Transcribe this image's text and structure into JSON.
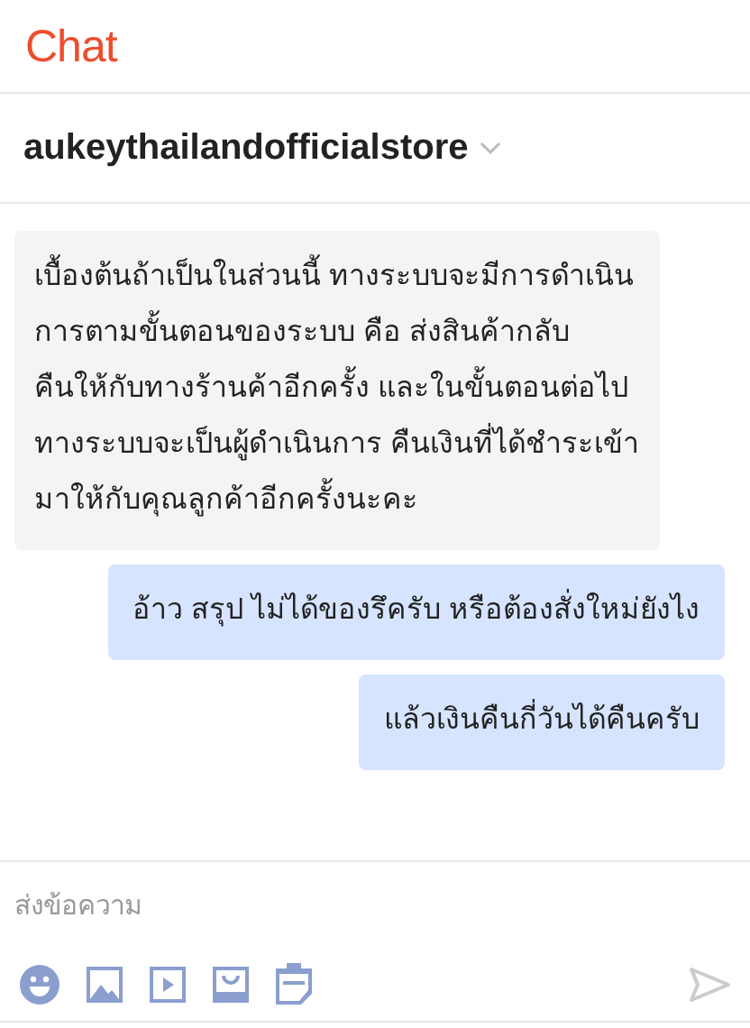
{
  "header": {
    "title": "Chat"
  },
  "conversation": {
    "name": "aukeythailandofficialstore"
  },
  "messages": [
    {
      "kind": "received",
      "text": "เบื้องต้นถ้าเป็นในส่วนนี้ ทางระบบจะมีการดำเนินการตามขั้นตอนของระบบ คือ ส่งสินค้ากลับคืนให้กับทางร้านค้าอีกครั้ง และในขั้นตอนต่อไปทางระบบจะเป็นผู้ดำเนินการ คืนเงินที่ได้ชำระเข้ามาให้กับคุณลูกค้าอีกครั้งนะคะ"
    },
    {
      "kind": "sent",
      "text": "อ้าว สรุป ไม่ได้ของรึครับ หรือต้องสั่งใหม่ยังไง"
    },
    {
      "kind": "sent",
      "text": "แล้วเงินคืนกี่วันได้คืนครับ"
    }
  ],
  "composer": {
    "placeholder": "ส่งข้อความ"
  }
}
